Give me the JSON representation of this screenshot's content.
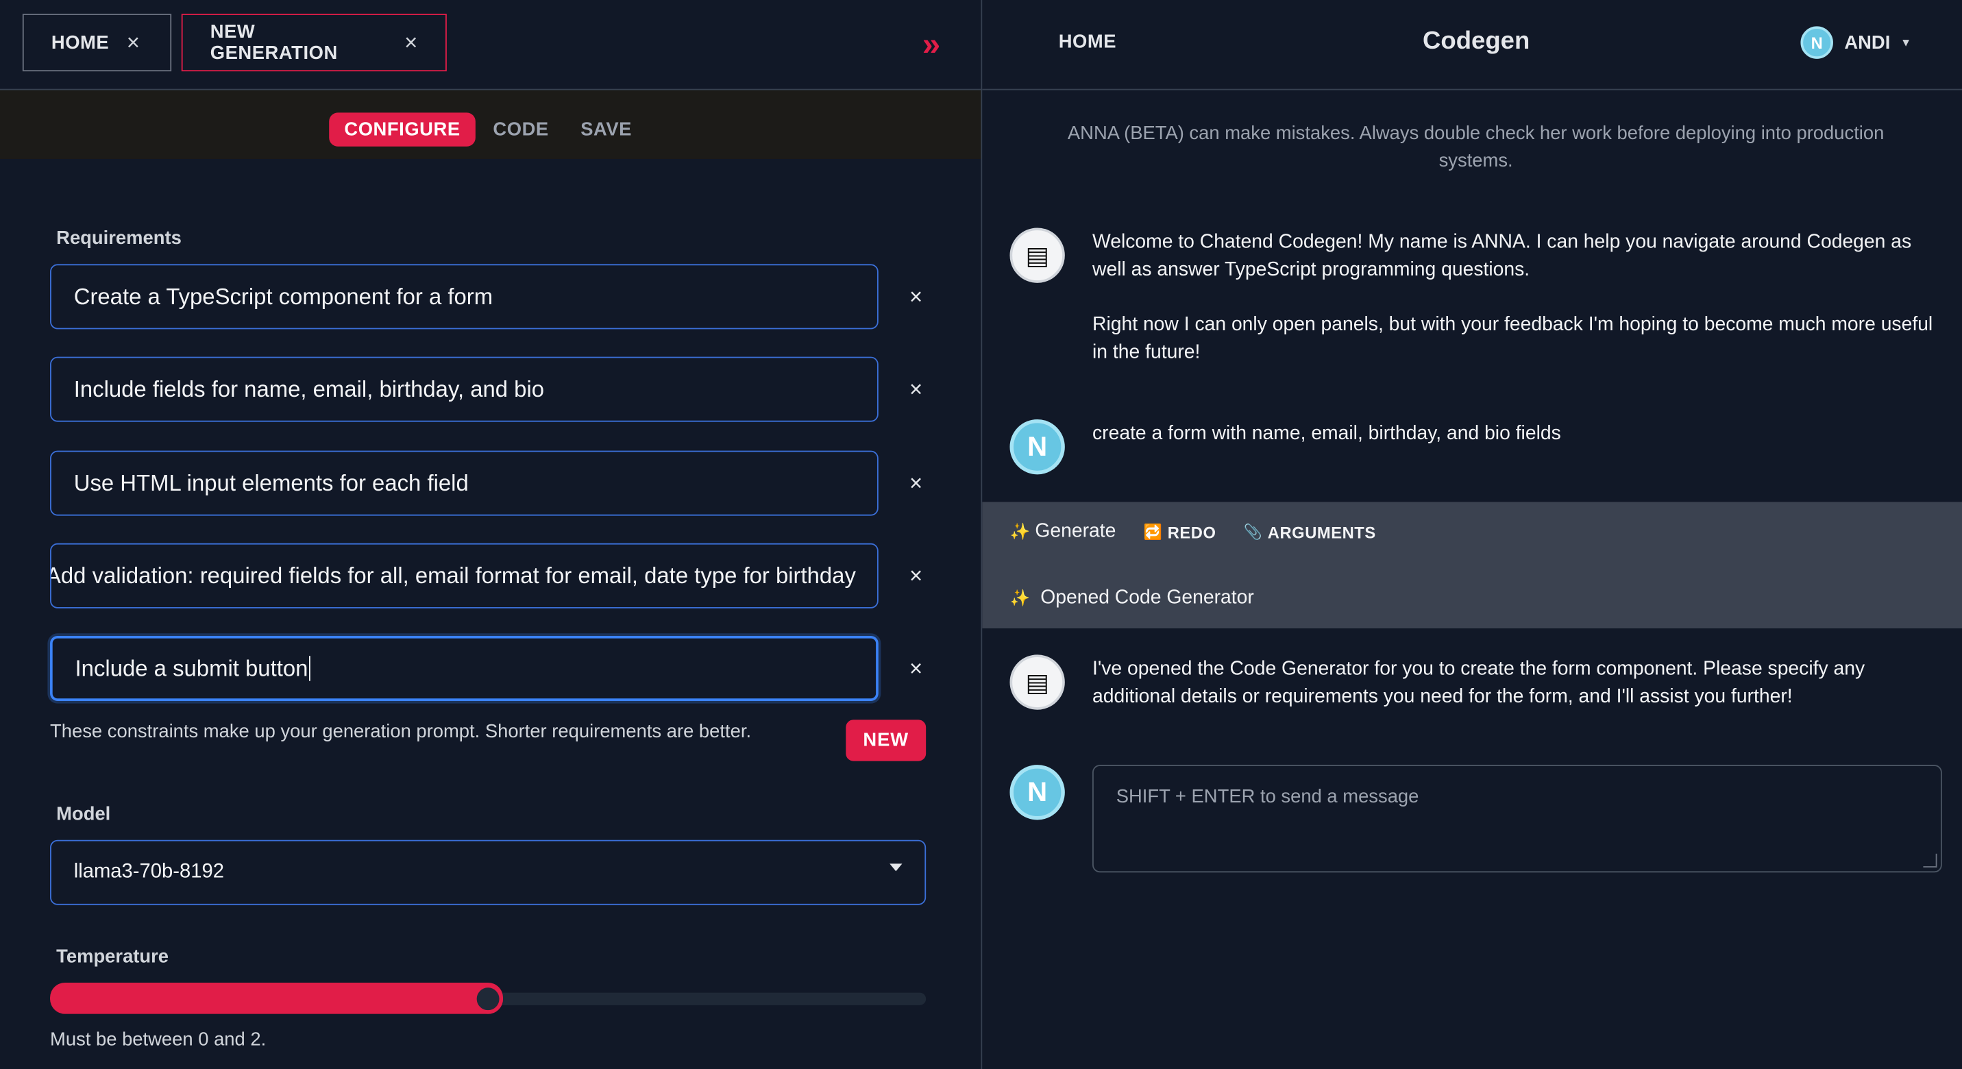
{
  "tabs": [
    {
      "label": "HOME"
    },
    {
      "label": "NEW GENERATION",
      "active": true
    }
  ],
  "icons": {
    "close": "×",
    "collapse": "»",
    "sparkle": "✨",
    "redo": "🔁",
    "arguments": "📎",
    "bot": "▤",
    "user_initial": "N"
  },
  "subnav": {
    "configure": "CONFIGURE",
    "code": "CODE",
    "save": "SAVE"
  },
  "requirements": {
    "label": "Requirements",
    "items": [
      "Create a TypeScript component for a form",
      "Include fields for name, email, birthday, and bio",
      "Use HTML input elements for each field",
      "Add validation: required fields for all, email format for email, date type for birthday",
      "Include a submit button"
    ],
    "hint": "These constraints make up your generation prompt. Shorter requirements are better.",
    "new_label": "NEW"
  },
  "model": {
    "label": "Model",
    "value": "llama3-70b-8192"
  },
  "temperature": {
    "label": "Temperature",
    "value_fraction": 0.5,
    "hint": "Must be between 0 and 2."
  },
  "right_header": {
    "home": "HOME",
    "title": "Codegen",
    "user": "ANDI"
  },
  "disclaimer": "ANNA (BETA) can make mistakes. Always double check her work before deploying into production systems.",
  "chat": {
    "welcome_1": "Welcome to Chatend Codegen! My name is ANNA. I can help you navigate around Codegen as well as answer TypeScript programming questions.",
    "welcome_2": "Right now I can only open panels, but with your feedback I'm hoping to become much more useful in the future!",
    "user_msg": "create a form with name, email, birthday, and bio fields",
    "tool_generate": "Generate",
    "tool_redo": "REDO",
    "tool_arguments": "ARGUMENTS",
    "tool_opened": "Opened Code Generator",
    "reply": "I've opened the Code Generator for you to create the form component. Please specify any additional details or requirements you need for the form, and I'll assist you further!",
    "composer_placeholder": "SHIFT + ENTER to send a message"
  },
  "colors": {
    "accent": "#e11d48",
    "input_border": "#3b6fd8",
    "background": "#111827",
    "tool_bg": "#3b4250"
  }
}
